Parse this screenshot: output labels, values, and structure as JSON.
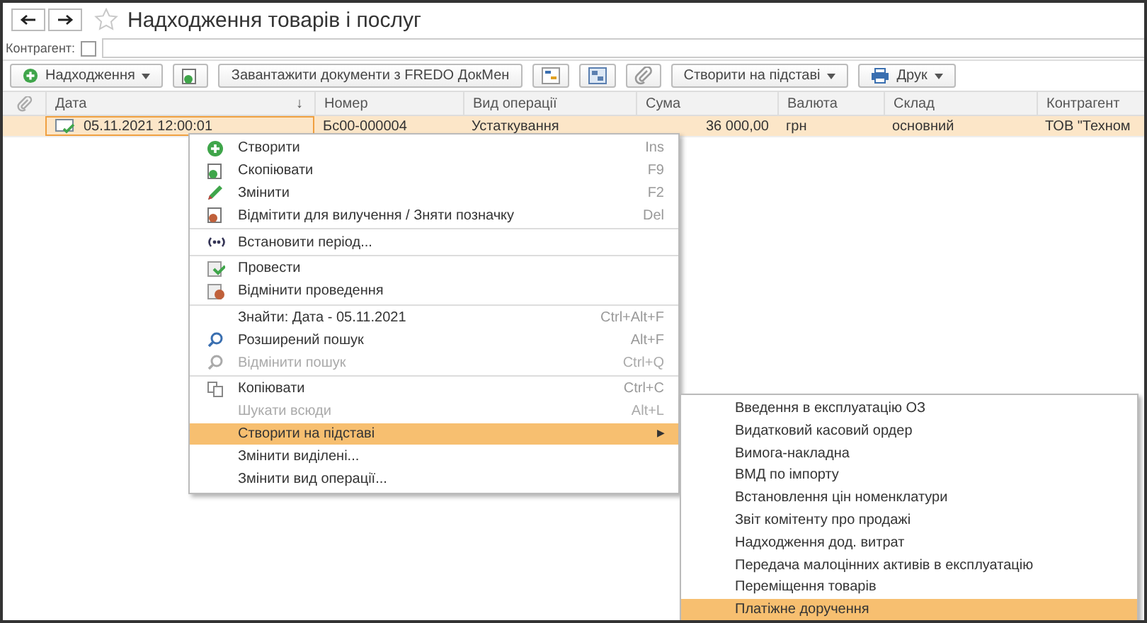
{
  "window": {
    "title": "Надходження товарів і послуг"
  },
  "filter": {
    "label": "Контрагент:",
    "checked": false
  },
  "toolbar": [
    {
      "kind": "menu",
      "label": "Надходження"
    },
    {
      "kind": "icon"
    },
    {
      "kind": "text",
      "label": "Завантажити документи з FREDO ДокМен"
    },
    {
      "kind": "icon"
    },
    {
      "kind": "icon"
    },
    {
      "kind": "icon"
    },
    {
      "kind": "menu",
      "label": "Створити на підставі"
    },
    {
      "kind": "menu",
      "label": "Друк"
    }
  ],
  "table": {
    "columns": [
      {
        "label": "Дата",
        "sort": "↓"
      },
      {
        "label": "Номер"
      },
      {
        "label": "Вид операції"
      },
      {
        "label": "Сума"
      },
      {
        "label": "Валюта"
      },
      {
        "label": "Склад"
      },
      {
        "label": "Контрагент"
      }
    ],
    "rows": [
      {
        "selected": true,
        "cells": [
          "05.11.2021 12:00:01",
          "Бс00-000004",
          "Устаткування",
          "36 000,00",
          "грн",
          "основний",
          "ТОВ \"Техном"
        ]
      }
    ]
  },
  "context_menu": [
    {
      "kind": "item",
      "label": "Створити",
      "shortcut": "Ins",
      "disabled": false,
      "selected": false
    },
    {
      "kind": "item",
      "label": "Скопіювати",
      "shortcut": "F9",
      "disabled": false,
      "selected": false
    },
    {
      "kind": "item",
      "label": "Змінити",
      "shortcut": "F2",
      "disabled": false,
      "selected": false
    },
    {
      "kind": "item",
      "label": "Відмітити для вилучення / Зняти позначку",
      "shortcut": "Del",
      "disabled": false,
      "selected": false
    },
    {
      "kind": "separator"
    },
    {
      "kind": "item",
      "label": "Встановити період...",
      "disabled": false,
      "selected": false
    },
    {
      "kind": "separator"
    },
    {
      "kind": "item",
      "label": "Провести",
      "disabled": false,
      "selected": false
    },
    {
      "kind": "item",
      "label": "Відмінити проведення",
      "disabled": false,
      "selected": false
    },
    {
      "kind": "separator"
    },
    {
      "kind": "item",
      "label": "Знайти: Дата - 05.11.2021",
      "shortcut": "Ctrl+Alt+F",
      "disabled": false,
      "selected": false
    },
    {
      "kind": "item",
      "label": "Розширений пошук",
      "shortcut": "Alt+F",
      "disabled": false,
      "selected": false
    },
    {
      "kind": "item",
      "label": "Відмінити пошук",
      "shortcut": "Ctrl+Q",
      "disabled": true,
      "selected": false
    },
    {
      "kind": "separator"
    },
    {
      "kind": "item",
      "label": "Копіювати",
      "shortcut": "Ctrl+C",
      "disabled": false,
      "selected": false
    },
    {
      "kind": "item",
      "label": "Шукати всюди",
      "shortcut": "Alt+L",
      "disabled": true,
      "selected": false
    },
    {
      "kind": "item",
      "label": "Створити на підставі",
      "submenu": "▶",
      "disabled": false,
      "selected": true
    },
    {
      "kind": "item",
      "label": "Змінити виділені...",
      "disabled": false,
      "selected": false
    },
    {
      "kind": "item",
      "label": "Змінити вид операції...",
      "disabled": false,
      "selected": false
    }
  ],
  "submenu": [
    {
      "label": "Введення в експлуатацію ОЗ",
      "selected": false
    },
    {
      "label": "Видатковий касовий ордер",
      "selected": false
    },
    {
      "label": "Вимога-накладна",
      "selected": false
    },
    {
      "label": "ВМД по імпорту",
      "selected": false
    },
    {
      "label": "Встановлення цін номенклатури",
      "selected": false
    },
    {
      "label": "Звіт комітенту про продажі",
      "selected": false
    },
    {
      "label": "Надходження дод. витрат",
      "selected": false
    },
    {
      "label": "Передача малоцінних активів в експлуатацію",
      "selected": false
    },
    {
      "label": "Переміщення товарів",
      "selected": false
    },
    {
      "label": "Платіжне доручення",
      "selected": true
    }
  ]
}
